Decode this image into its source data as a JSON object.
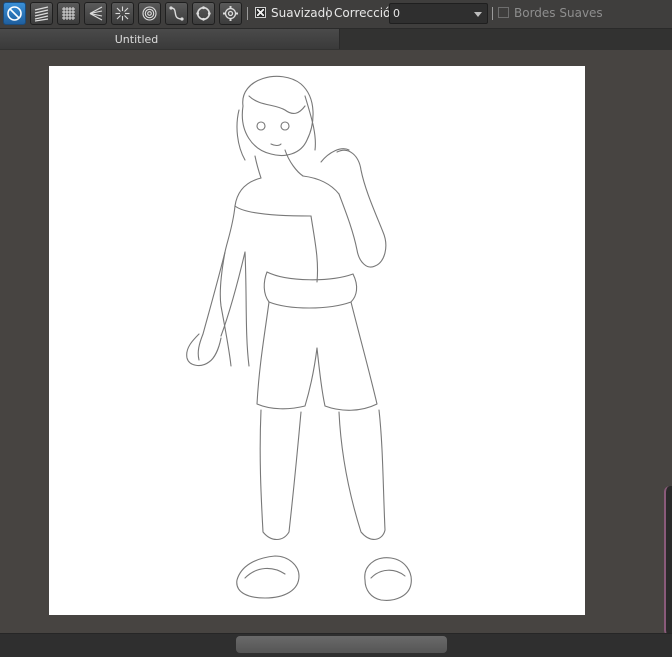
{
  "toolbar": {
    "tools": [
      {
        "icon": "no-ruler-icon",
        "active": true
      },
      {
        "icon": "parallel-lines-ruler-icon",
        "active": false
      },
      {
        "icon": "grid-ruler-icon",
        "active": false
      },
      {
        "icon": "perspective-ruler-icon",
        "active": false
      },
      {
        "icon": "radial-lines-ruler-icon",
        "active": false
      },
      {
        "icon": "concentric-circles-ruler-icon",
        "active": false
      },
      {
        "icon": "curve-ruler-icon",
        "active": false
      },
      {
        "icon": "ellipse-ruler-icon",
        "active": false
      },
      {
        "icon": "settings-gear-icon",
        "active": false
      }
    ],
    "smoothing_label": "Suavizado",
    "smoothing_checked": true,
    "correction_label": "Corrección",
    "correction_value": "0",
    "soft_edges_label": "Bordes Suaves",
    "soft_edges_checked": false
  },
  "tabs": [
    {
      "label": "Untitled",
      "active": true
    }
  ],
  "canvas": {
    "content": "pencil sketch of a standing figure"
  },
  "colors": {
    "accent": "#2f7bc4",
    "background": "#474441",
    "canvas": "#ffffff"
  }
}
